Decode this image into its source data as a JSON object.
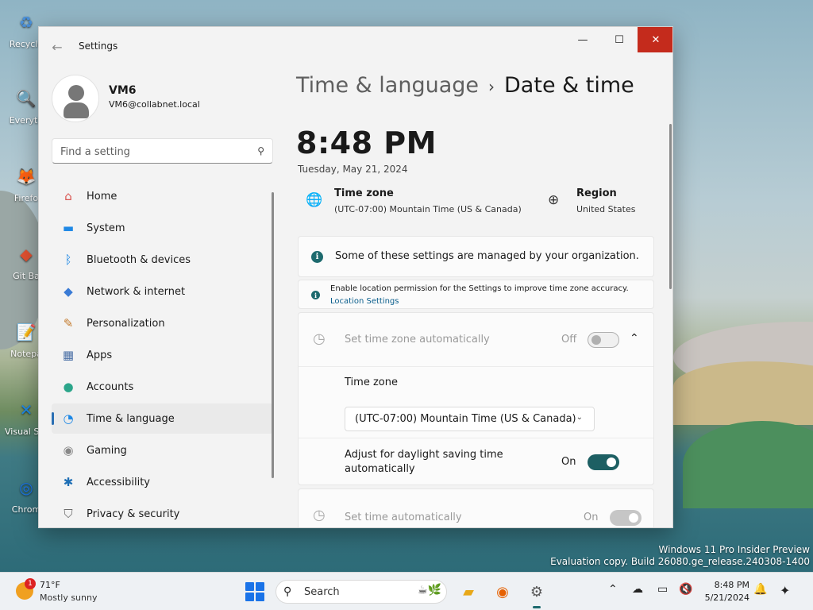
{
  "desktop": {
    "icons": [
      {
        "label": "Recycle",
        "glyph": "♻",
        "color": "#4a90d9"
      },
      {
        "label": "Everyth",
        "glyph": "🔍",
        "color": "#e07020"
      },
      {
        "label": "Firefo",
        "glyph": "🦊",
        "color": "#e66000"
      },
      {
        "label": "Git Ba",
        "glyph": "◆",
        "color": "#e05030"
      },
      {
        "label": "Notepa",
        "glyph": "📝",
        "color": "#6aa84f"
      },
      {
        "label": "Visual St Cod",
        "glyph": "✕",
        "color": "#1e88e5"
      },
      {
        "label": "Chrom",
        "glyph": "◎",
        "color": "#1a73e8"
      }
    ],
    "watermark": {
      "line1": "Windows 11 Pro Insider Preview",
      "line2": "Evaluation copy. Build 26080.ge_release.240308-1400"
    }
  },
  "window": {
    "title": "Settings",
    "controls": {
      "minimize": "—",
      "maximize": "☐",
      "close": "✕"
    }
  },
  "user": {
    "name": "VM6",
    "email": "VM6@collabnet.local"
  },
  "search": {
    "placeholder": "Find a setting"
  },
  "nav": [
    {
      "label": "Home",
      "icon": "home-icon",
      "glyph": "⌂",
      "color": "#d9534f"
    },
    {
      "label": "System",
      "icon": "monitor-icon",
      "glyph": "▬",
      "color": "#1e88e5"
    },
    {
      "label": "Bluetooth & devices",
      "icon": "bluetooth-icon",
      "glyph": "ᛒ",
      "color": "#1e88e5"
    },
    {
      "label": "Network & internet",
      "icon": "wifi-icon",
      "glyph": "◆",
      "color": "#3a7bd5"
    },
    {
      "label": "Personalization",
      "icon": "brush-icon",
      "glyph": "✎",
      "color": "#c47a2c"
    },
    {
      "label": "Apps",
      "icon": "apps-icon",
      "glyph": "▦",
      "color": "#4a6fa5"
    },
    {
      "label": "Accounts",
      "icon": "person-icon",
      "glyph": "●",
      "color": "#2ba58a"
    },
    {
      "label": "Time & language",
      "icon": "globe-clock-icon",
      "glyph": "◔",
      "color": "#1e88e5",
      "active": true
    },
    {
      "label": "Gaming",
      "icon": "gamepad-icon",
      "glyph": "◉",
      "color": "#888888"
    },
    {
      "label": "Accessibility",
      "icon": "accessibility-icon",
      "glyph": "✱",
      "color": "#1e6fb5"
    },
    {
      "label": "Privacy & security",
      "icon": "shield-icon",
      "glyph": "⛉",
      "color": "#6b6b6b"
    }
  ],
  "page": {
    "breadcrumb_parent": "Time & language",
    "breadcrumb_sep": "›",
    "breadcrumb_current": "Date & time",
    "time": "8:48 PM",
    "date": "Tuesday, May 21, 2024",
    "timezone_title": "Time zone",
    "timezone_value": "(UTC-07:00) Mountain Time (US & Canada)",
    "region_title": "Region",
    "region_value": "United States"
  },
  "notices": {
    "managed": "Some of these settings are managed by your organization.",
    "location_text": "Enable location permission for the Settings to improve time zone accuracy.",
    "location_link": "Location Settings"
  },
  "settings": {
    "auto_timezone": {
      "label": "Set time zone automatically",
      "state": "Off"
    },
    "timezone": {
      "label": "Time zone",
      "value": "(UTC-07:00) Mountain Time (US & Canada)"
    },
    "dst": {
      "label": "Adjust for daylight saving time automatically",
      "state": "On"
    },
    "auto_time": {
      "label": "Set time automatically",
      "state": "On"
    }
  },
  "taskbar": {
    "weather_temp": "71°F",
    "weather_desc": "Mostly sunny",
    "weather_badge": "1",
    "search_label": "Search",
    "time": "8:48 PM",
    "date": "5/21/2024"
  }
}
